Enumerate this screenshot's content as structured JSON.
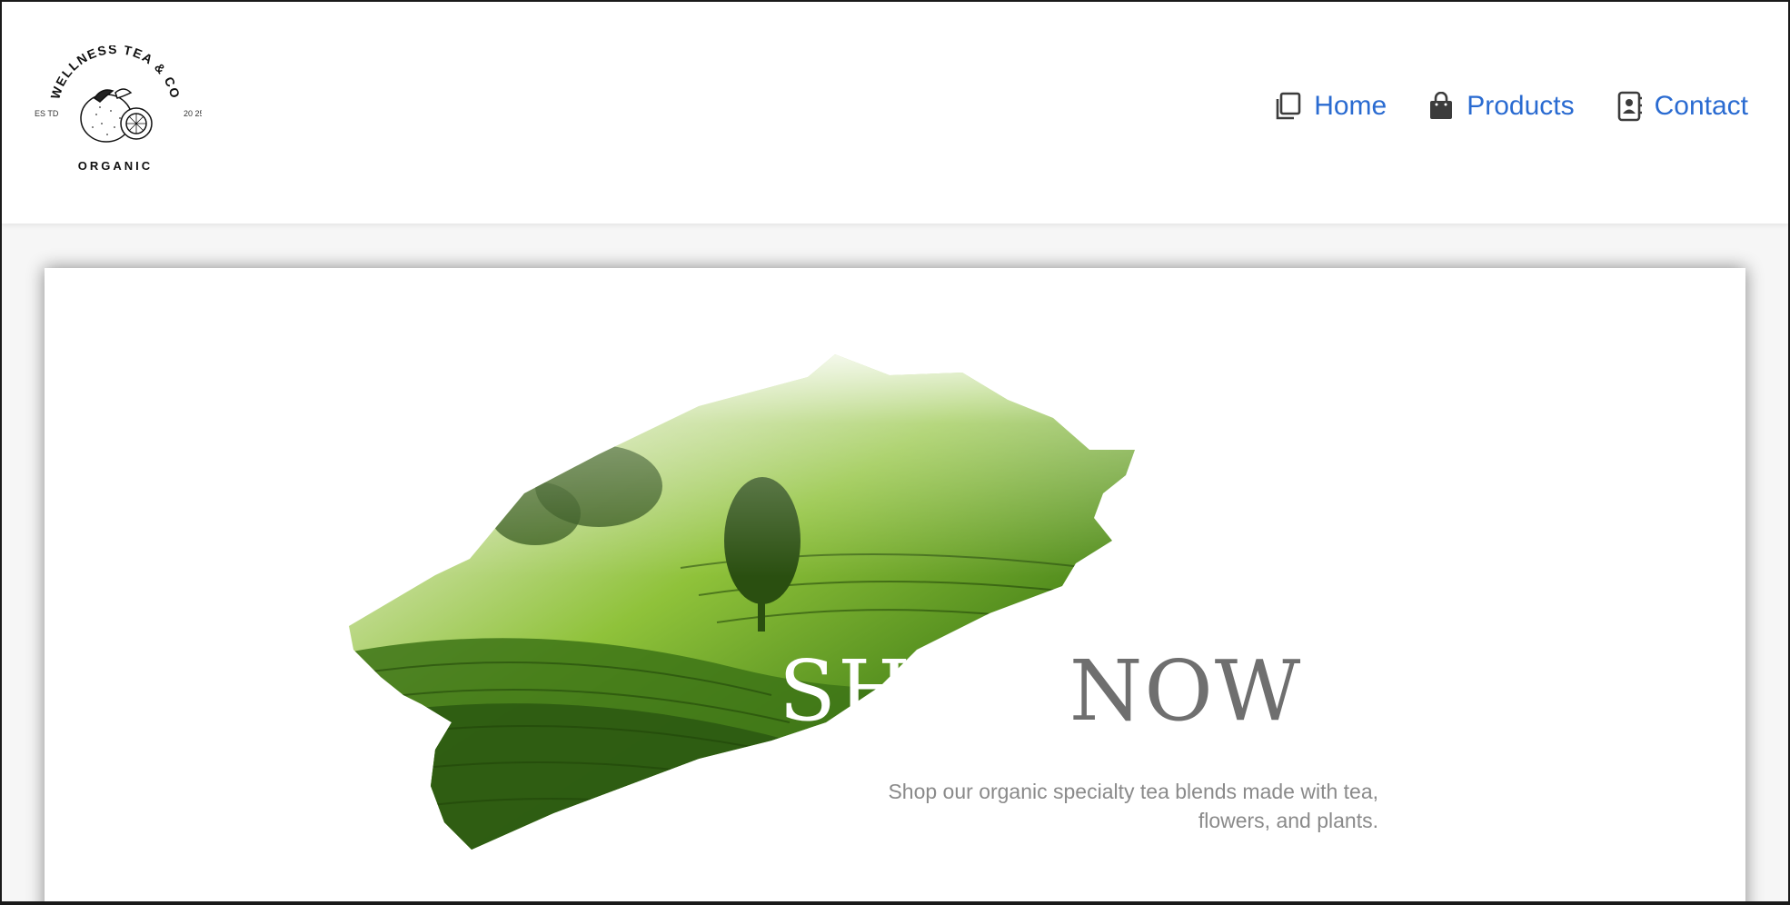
{
  "brand": {
    "name": "WELLNESS TEA & CO",
    "tagline": "ORGANIC",
    "est_left": "ES TD",
    "est_right": "20 25"
  },
  "nav": {
    "items": [
      {
        "label": "Home",
        "icon": "copy-pages-icon"
      },
      {
        "label": "Products",
        "icon": "shopping-bag-icon"
      },
      {
        "label": "Contact",
        "icon": "address-book-icon"
      }
    ]
  },
  "hero": {
    "title_part1": "SHOP",
    "title_part2": " NOW",
    "subtitle": "Shop our organic specialty tea blends made with tea, flowers, and plants.",
    "image": "tea-plantation-brushstroke"
  },
  "colors": {
    "link": "#2a6bd1",
    "icon": "#3c3c3c",
    "title_gray": "#6f6f6f",
    "subtitle_gray": "#8a8a8a",
    "tea_green_dark": "#2c5a12",
    "tea_green_light": "#9ccc3a"
  }
}
